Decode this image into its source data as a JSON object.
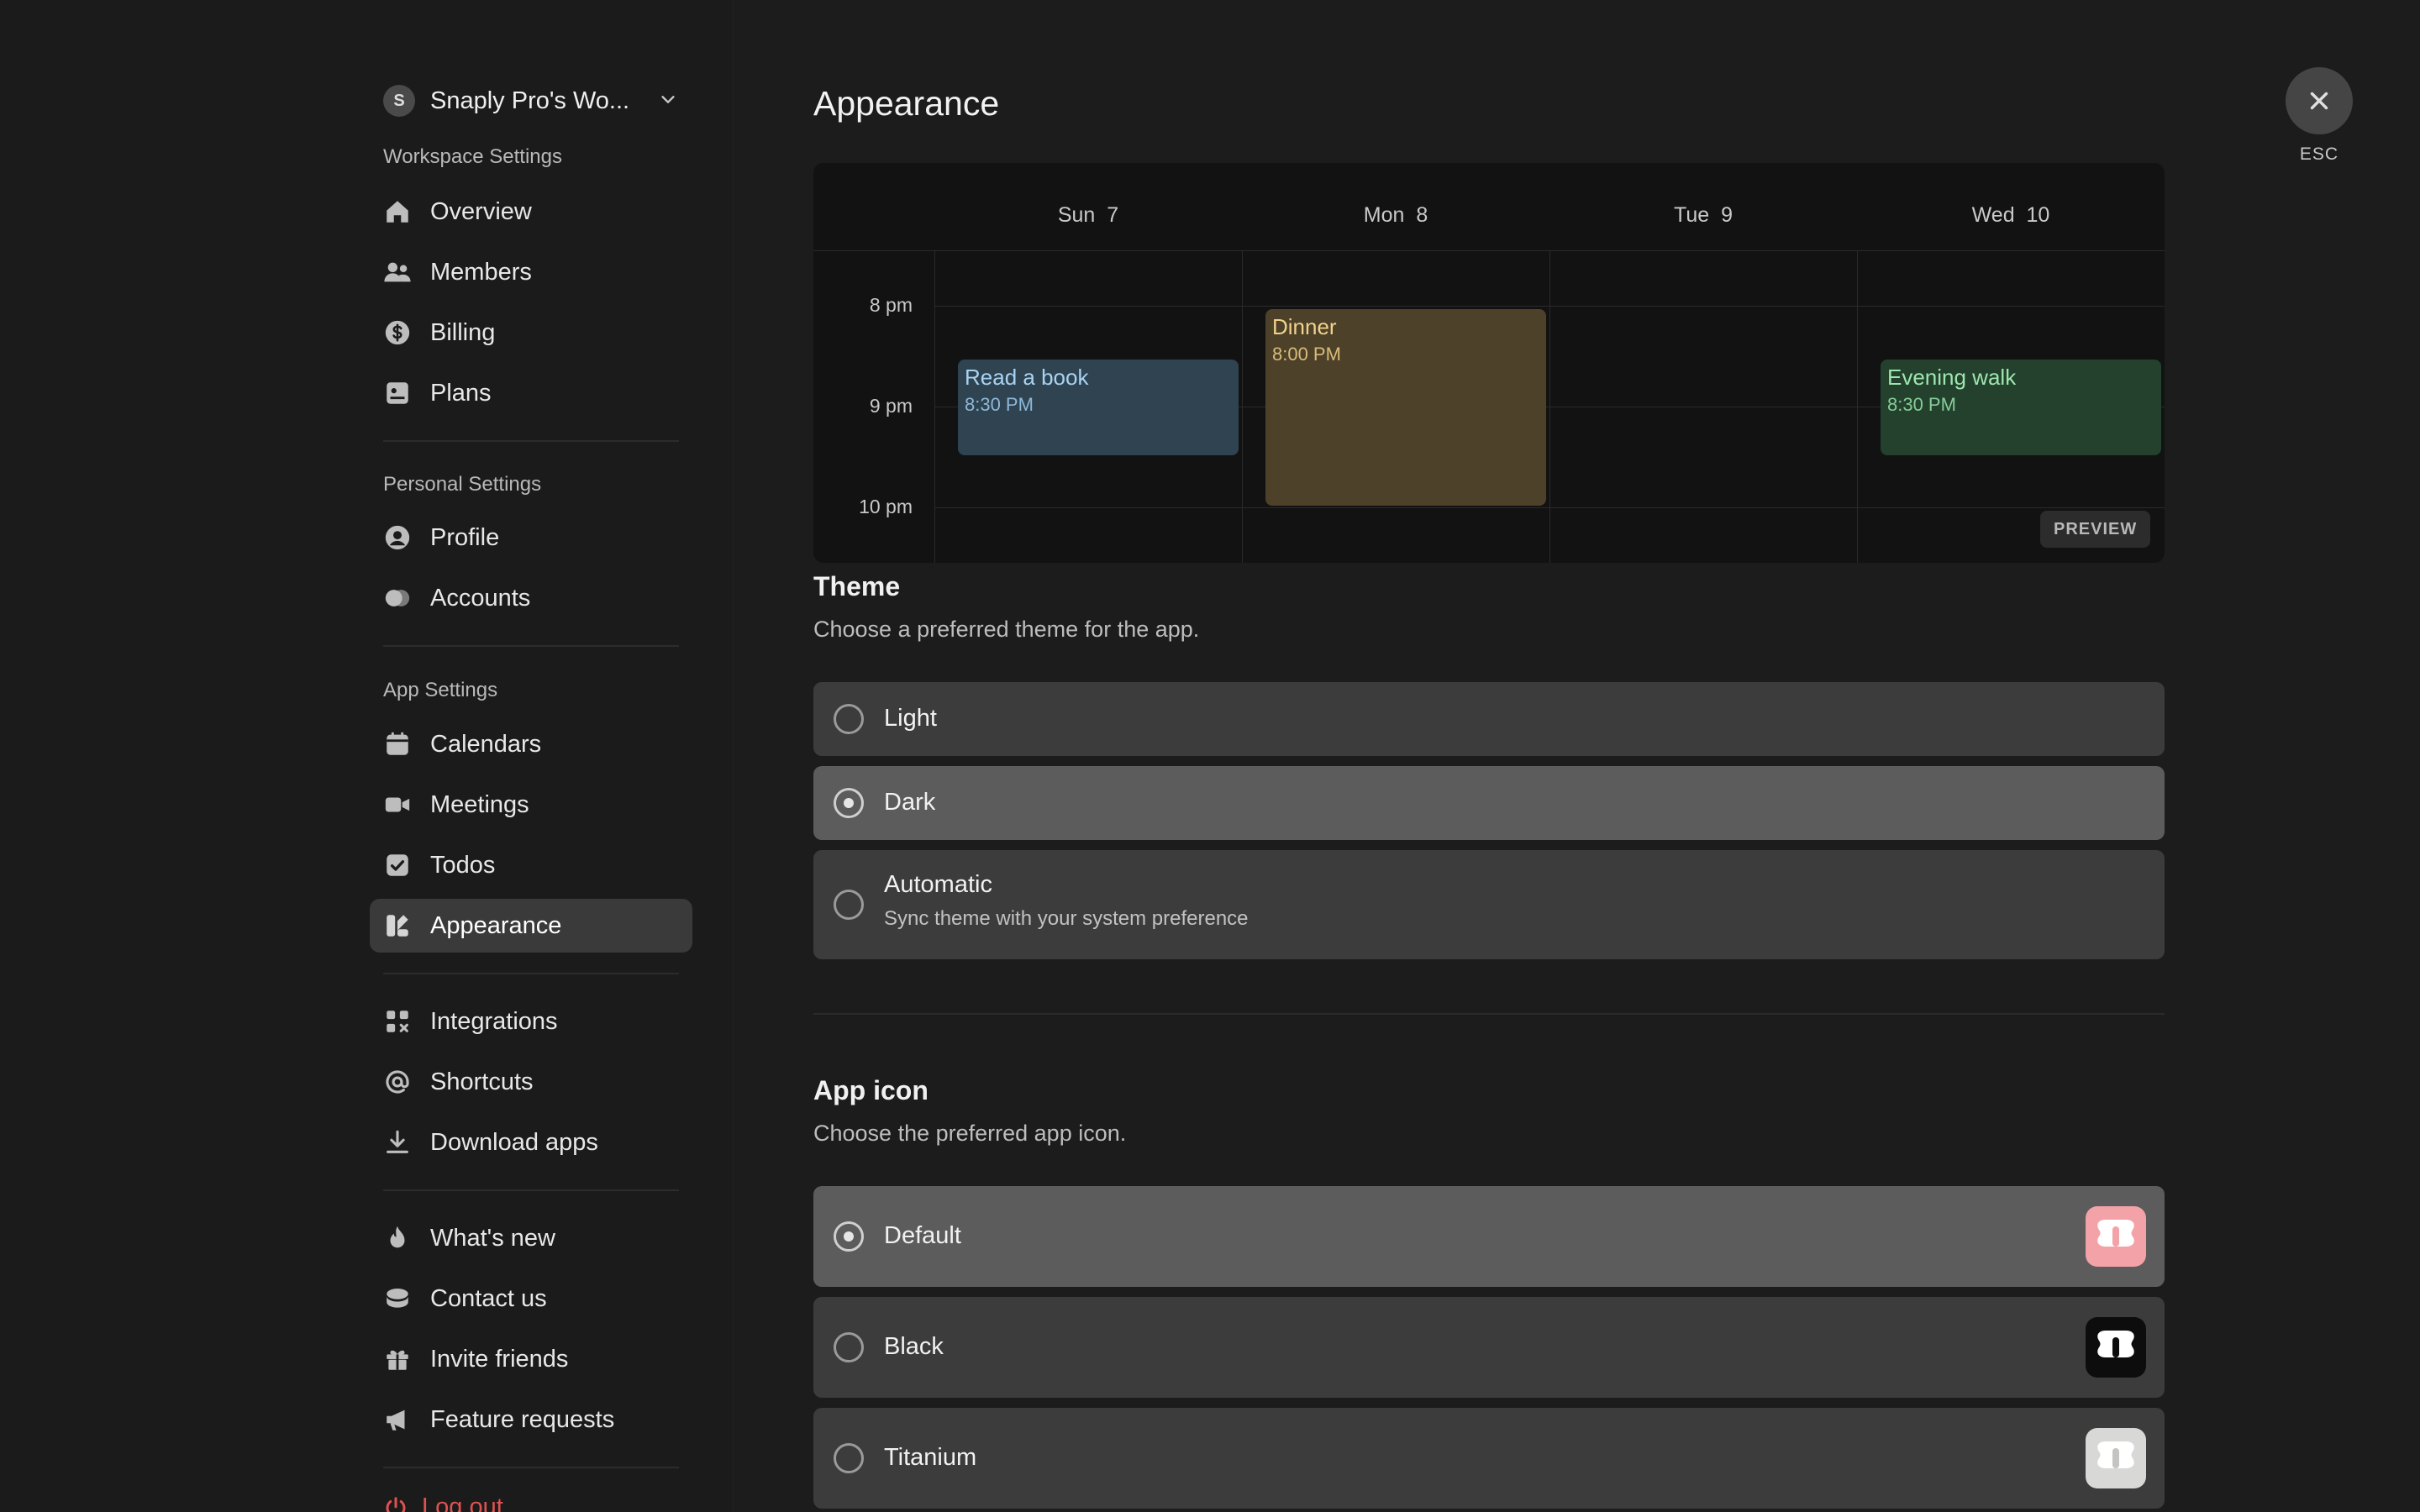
{
  "sidebar": {
    "workspace": {
      "initial": "S",
      "name": "Snaply Pro's Wo..."
    },
    "sections": {
      "workspace": "Workspace Settings",
      "personal": "Personal Settings",
      "app": "App Settings"
    },
    "items": {
      "overview": "Overview",
      "members": "Members",
      "billing": "Billing",
      "plans": "Plans",
      "profile": "Profile",
      "accounts": "Accounts",
      "calendars": "Calendars",
      "meetings": "Meetings",
      "todos": "Todos",
      "appearance": "Appearance",
      "integrations": "Integrations",
      "shortcuts": "Shortcuts",
      "download_apps": "Download apps",
      "whats_new": "What's new",
      "contact_us": "Contact us",
      "invite_friends": "Invite friends",
      "feature_requests": "Feature requests",
      "logout": "Log out"
    },
    "active": "appearance"
  },
  "header": {
    "title": "Appearance",
    "close_hint": "ESC"
  },
  "preview": {
    "days": [
      {
        "dow": "Sun",
        "date": "7"
      },
      {
        "dow": "Mon",
        "date": "8"
      },
      {
        "dow": "Tue",
        "date": "9"
      },
      {
        "dow": "Wed",
        "date": "10"
      }
    ],
    "times": [
      "8 pm",
      "9 pm",
      "10 pm"
    ],
    "events": [
      {
        "title": "Read a book",
        "time": "8:30 PM",
        "day": "Sun"
      },
      {
        "title": "Dinner",
        "time": "8:00 PM",
        "day": "Mon"
      },
      {
        "title": "Evening walk",
        "time": "8:30 PM",
        "day": "Wed"
      }
    ],
    "badge": "PREVIEW"
  },
  "theme": {
    "title": "Theme",
    "description": "Choose a preferred theme for the app.",
    "options": [
      {
        "label": "Light"
      },
      {
        "label": "Dark"
      },
      {
        "label": "Automatic",
        "sublabel": "Sync theme with your system preference"
      }
    ],
    "selected": "Dark"
  },
  "app_icon": {
    "title": "App icon",
    "description": "Choose the preferred app icon.",
    "options": [
      {
        "label": "Default",
        "icon_color": "#f3a3a8"
      },
      {
        "label": "Black",
        "icon_color": "#0d0d0d"
      },
      {
        "label": "Titanium",
        "icon_color": "#d8d8d6"
      }
    ],
    "selected": "Default"
  },
  "colors": {
    "accent_logout": "#e05252"
  }
}
